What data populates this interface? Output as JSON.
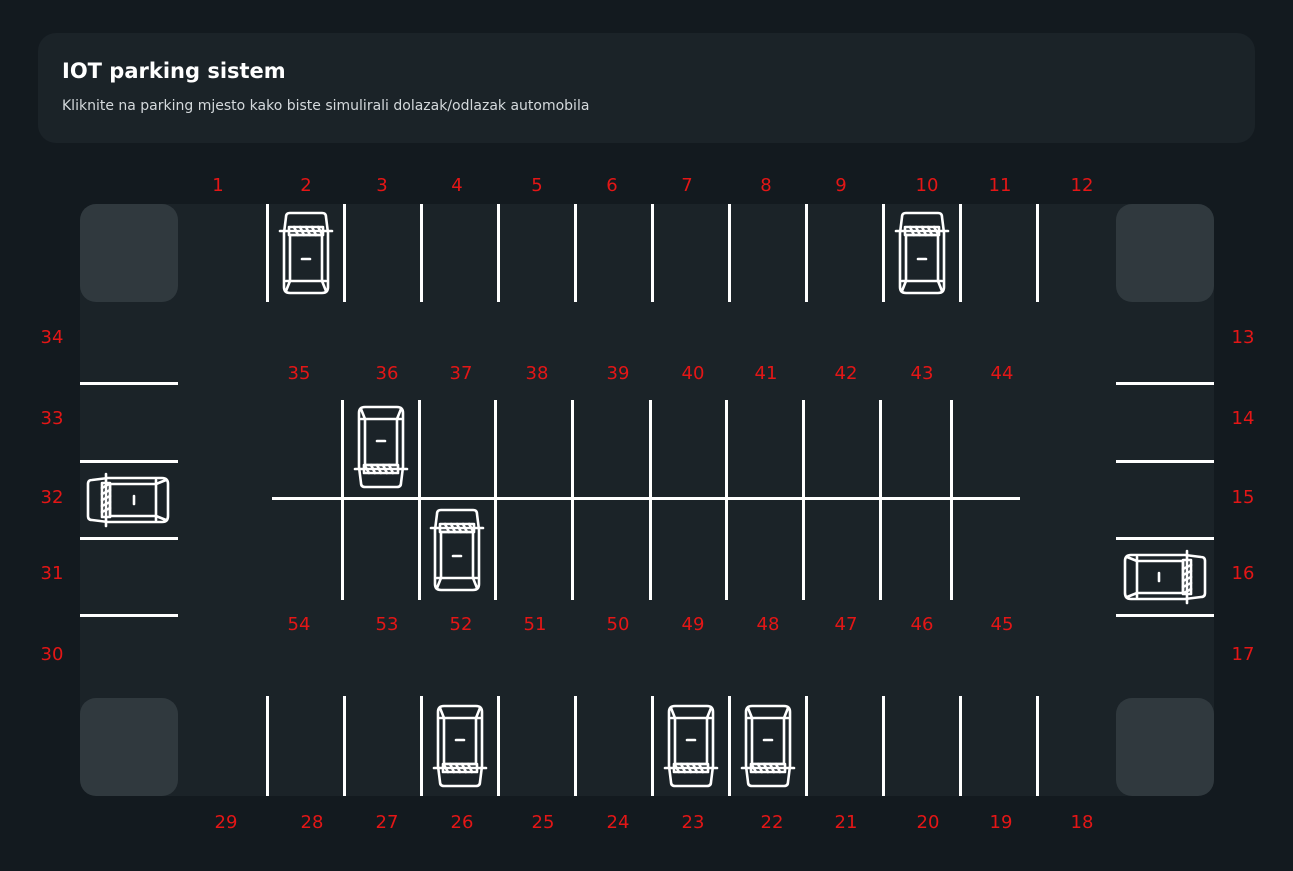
{
  "header": {
    "title": "IOT parking sistem",
    "subtitle": "Kliknite na parking mjesto kako biste simulirali dolazak/odlazak automobila"
  },
  "colors": {
    "background": "#131a1f",
    "lot": "#1b2328",
    "corner_block": "#30393e",
    "line": "#ffffff",
    "spot_number": "#e41616"
  },
  "spots": {
    "top": [
      "1",
      "2",
      "3",
      "4",
      "5",
      "6",
      "7",
      "8",
      "9",
      "10",
      "11",
      "12"
    ],
    "right": [
      "13",
      "14",
      "15",
      "16",
      "17"
    ],
    "bottom": [
      "18",
      "19",
      "20",
      "21",
      "22",
      "23",
      "24",
      "25",
      "26",
      "27",
      "28",
      "29"
    ],
    "left": [
      "30",
      "31",
      "32",
      "33",
      "34"
    ],
    "center_upper": [
      "35",
      "36",
      "37",
      "38",
      "39",
      "40",
      "41",
      "42",
      "43",
      "44"
    ],
    "center_lower": [
      "45",
      "46",
      "47",
      "48",
      "49",
      "50",
      "51",
      "52",
      "53",
      "54"
    ]
  },
  "occupied": [
    "2",
    "10",
    "22",
    "23",
    "26",
    "32",
    "36",
    "52",
    "16"
  ],
  "car_icon": "car-top-view-icon"
}
